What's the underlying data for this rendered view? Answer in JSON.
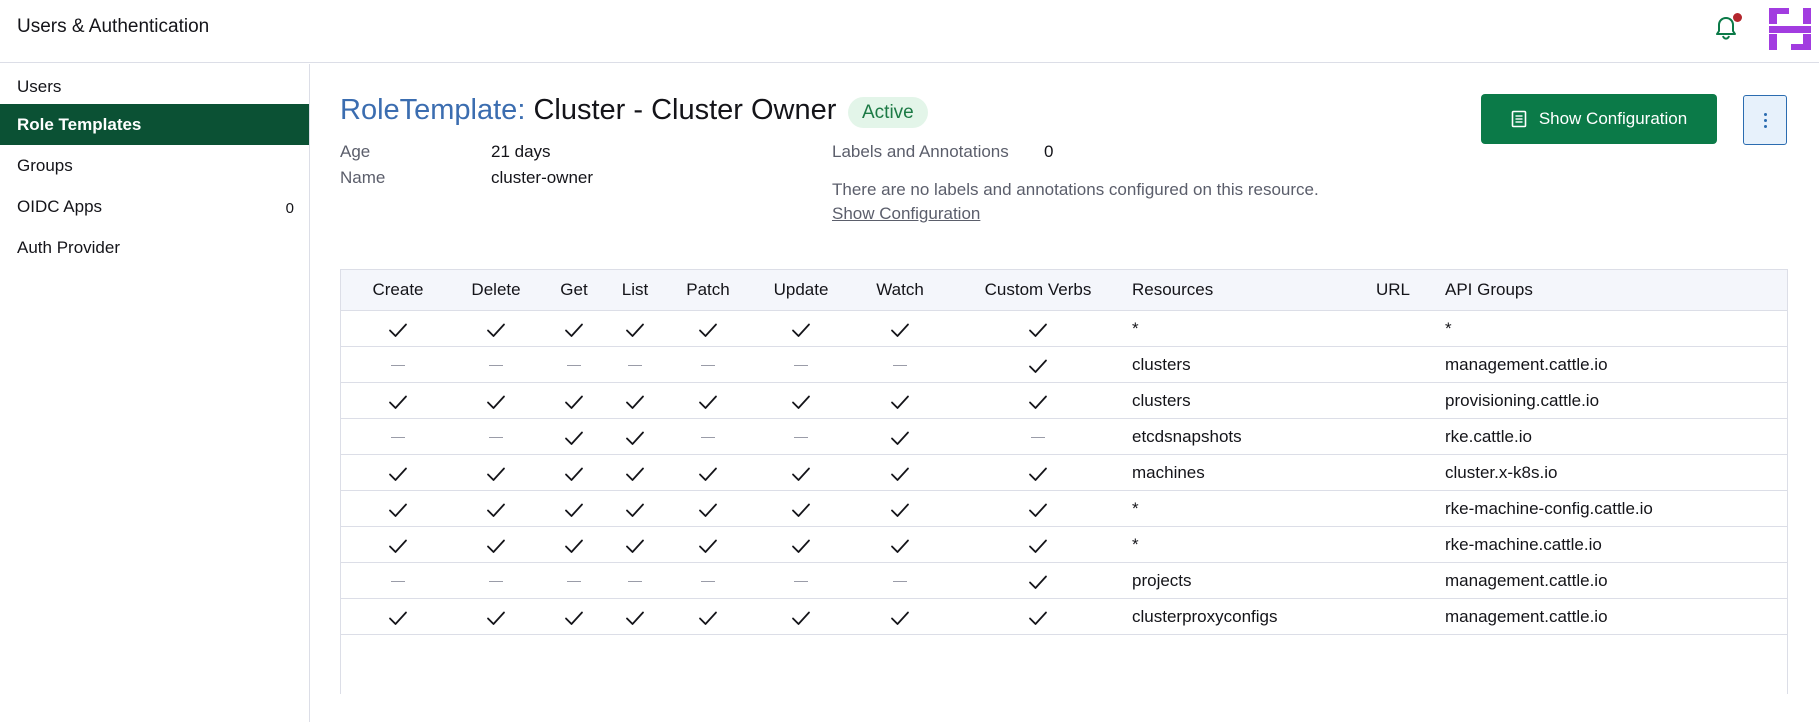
{
  "header": {
    "title": "Users & Authentication",
    "bell_icon": "bell-icon",
    "logo_icon": "brand-logo-icon",
    "accent": "#0b7a48"
  },
  "sidebar": {
    "items": [
      {
        "label": "Users",
        "count": "",
        "active": false
      },
      {
        "label": "Role Templates",
        "count": "",
        "active": true
      },
      {
        "label": "Groups",
        "count": "",
        "active": false
      },
      {
        "label": "OIDC Apps",
        "count": "0",
        "active": false
      },
      {
        "label": "Auth Provider",
        "count": "",
        "active": false
      }
    ]
  },
  "page": {
    "type_label": "RoleTemplate:",
    "name": "Cluster - Cluster Owner",
    "status": "Active",
    "show_config_button": "Show Configuration",
    "more_icon": "kebab-vertical-icon"
  },
  "details": {
    "age_label": "Age",
    "age_value": "21 days",
    "name_label": "Name",
    "name_value": "cluster-owner",
    "labels_label": "Labels and Annotations",
    "labels_count": "0",
    "labels_note": "There are no labels and annotations configured on this resource.",
    "labels_link": "Show Configuration"
  },
  "table": {
    "columns": [
      "Create",
      "Delete",
      "Get",
      "List",
      "Patch",
      "Update",
      "Watch",
      "Custom Verbs",
      "Resources",
      "URL",
      "API Groups"
    ],
    "rows": [
      {
        "verbs": [
          true,
          true,
          true,
          true,
          true,
          true,
          true,
          true
        ],
        "resource": "*",
        "url": "",
        "api_group": "*"
      },
      {
        "verbs": [
          false,
          false,
          false,
          false,
          false,
          false,
          false,
          true
        ],
        "resource": "clusters",
        "url": "",
        "api_group": "management.cattle.io"
      },
      {
        "verbs": [
          true,
          true,
          true,
          true,
          true,
          true,
          true,
          true
        ],
        "resource": "clusters",
        "url": "",
        "api_group": "provisioning.cattle.io"
      },
      {
        "verbs": [
          false,
          false,
          true,
          true,
          false,
          false,
          true,
          false
        ],
        "resource": "etcdsnapshots",
        "url": "",
        "api_group": "rke.cattle.io"
      },
      {
        "verbs": [
          true,
          true,
          true,
          true,
          true,
          true,
          true,
          true
        ],
        "resource": "machines",
        "url": "",
        "api_group": "cluster.x-k8s.io"
      },
      {
        "verbs": [
          true,
          true,
          true,
          true,
          true,
          true,
          true,
          true
        ],
        "resource": "*",
        "url": "",
        "api_group": "rke-machine-config.cattle.io"
      },
      {
        "verbs": [
          true,
          true,
          true,
          true,
          true,
          true,
          true,
          true
        ],
        "resource": "*",
        "url": "",
        "api_group": "rke-machine.cattle.io"
      },
      {
        "verbs": [
          false,
          false,
          false,
          false,
          false,
          false,
          false,
          true
        ],
        "resource": "projects",
        "url": "",
        "api_group": "management.cattle.io"
      },
      {
        "verbs": [
          true,
          true,
          true,
          true,
          true,
          true,
          true,
          true
        ],
        "resource": "clusterproxyconfigs",
        "url": "",
        "api_group": "management.cattle.io"
      }
    ]
  }
}
